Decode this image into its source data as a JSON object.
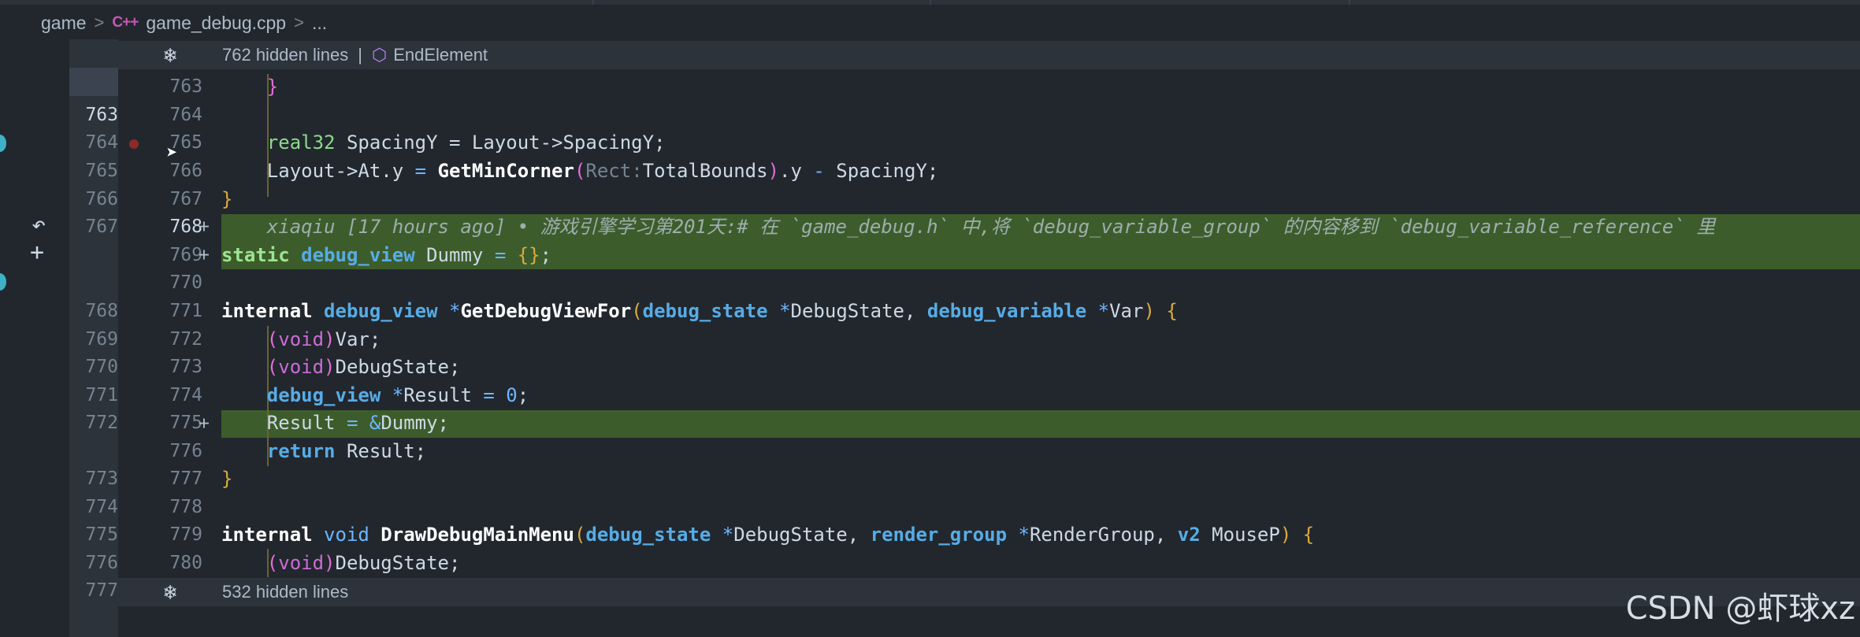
{
  "breadcrumb": {
    "folder": "game",
    "file_icon": "C++",
    "file": "game_debug.cpp",
    "ellipsis": "..."
  },
  "hidden_top": {
    "label": "762 hidden lines",
    "separator": "|",
    "symbol": "EndElement"
  },
  "hidden_bottom": {
    "label": "532 hidden lines"
  },
  "old_line_numbers": [
    "763",
    "764",
    "765",
    "766",
    "767",
    "768",
    "769",
    "770",
    "771",
    "772",
    "773",
    "774",
    "775",
    "776",
    "777"
  ],
  "new_line_numbers": [
    "763",
    "764",
    "765",
    "766",
    "767",
    "768",
    "769",
    "770",
    "771",
    "772",
    "773",
    "774",
    "775",
    "776",
    "777",
    "778",
    "779",
    "780"
  ],
  "added_marker": "+",
  "blame": "xiaqiu [17 hours ago] • 游戏引擎学习第201天:# 在 `game_debug.h` 中,将 `debug_variable_group` 的内容移到 `debug_variable_reference` 里",
  "code": {
    "l763": "}",
    "l765_type": "real32",
    "l765_rest": " SpacingY = Layout->SpacingY;",
    "l766_a": "Layout->At.y ",
    "l766_eq": "=",
    "l766_fn": "GetMinCorner",
    "l766_hint": "Rect:",
    "l766_arg": "TotalBounds",
    "l766_b": ".y ",
    "l766_minus": "-",
    "l766_c": " SpacingY;",
    "l767": "}",
    "l769_kw": "static",
    "l769_type": "debug_view",
    "l769_name": " Dummy ",
    "l769_eq": "=",
    "l769_init": "{}",
    "l769_end": ";",
    "l771_kw": "internal",
    "l771_type": "debug_view",
    "l771_ptr": "*",
    "l771_fn": "GetDebugViewFor",
    "l771_t1": "debug_state",
    "l771_p1": "DebugState, ",
    "l771_t2": "debug_variable",
    "l771_p2": "Var",
    "l772_void": "void",
    "l772_rest": "Var;",
    "l773_void": "void",
    "l773_rest": "DebugState;",
    "l774_type": "debug_view",
    "l774_rest": "Result ",
    "l774_eq": "=",
    "l774_num": "0",
    "l775_a": "Result ",
    "l775_eq": "=",
    "l775_amp": "&",
    "l775_b": "Dummy;",
    "l776_kw": "return",
    "l776_rest": " Result;",
    "l777": "}",
    "l779_kw": "internal",
    "l779_void": "void",
    "l779_fn": "DrawDebugMainMenu",
    "l779_t1": "debug_state",
    "l779_p1": "DebugState, ",
    "l779_t2": "render_group",
    "l779_p2": "RenderGroup, ",
    "l779_t3": "v2",
    "l779_p3": " MouseP",
    "l780_void": "void",
    "l780_rest": "DebugState;"
  },
  "watermark": "CSDN @虾球xz",
  "icons": {
    "unfold": "snowflake-icon",
    "symbol": "cube-icon",
    "revert": "undo-icon",
    "stage": "plus-icon"
  },
  "colors": {
    "added_line": "#3c5d2b",
    "background": "#22272e"
  }
}
